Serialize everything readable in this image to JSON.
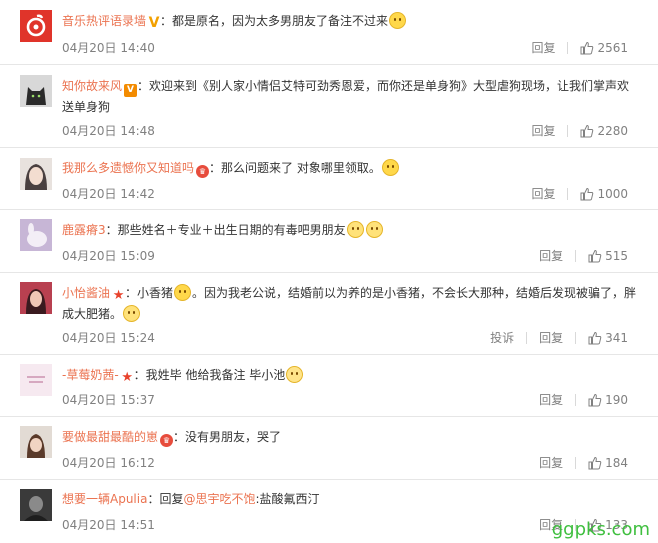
{
  "comments": [
    {
      "user": "音乐热评语录墙",
      "badge": "V",
      "text_before": "：都是原名，因为太多男朋友了备注不过来",
      "time": "04月20日 14:40",
      "reply_label": "回复",
      "likes": "2561",
      "avatar_color": "#e0342a",
      "emoji": "grin-emoji"
    },
    {
      "user": "知你故来风",
      "badge": "V",
      "text": "：欢迎来到《别人家小情侣艾特可劲秀恩爱，而你还是单身狗》大型虐狗现场，让我们掌声欢送单身狗",
      "time": "04月20日 14:48",
      "reply_label": "回复",
      "likes": "2280",
      "avatar_color": "#3a3a3a"
    },
    {
      "user": "我那么多遗憾你又知道吗",
      "badge": "♛",
      "text": "：那么问题来了 对象哪里领取。",
      "time": "04月20日 14:42",
      "reply_label": "回复",
      "likes": "1000",
      "avatar_color": "#d9cfc7",
      "emoji": "sweat-emoji"
    },
    {
      "user": "鹿露瘠3",
      "text": "：那些姓名＋专业＋出生日期的有毒吧男朋友",
      "time": "04月20日 15:09",
      "reply_label": "回复",
      "likes": "515",
      "avatar_color": "#b9a8c9",
      "emoji": "laugh-cry-emoji"
    },
    {
      "user": "小怡酱油",
      "badge": "★",
      "text_a": "：小香猪",
      "text_b": "。因为我老公说，结婚前以为养的是小香猪，不会长大那种，结婚后发现被骗了，胖成大肥猪。",
      "time": "04月20日 15:24",
      "report_label": "投诉",
      "reply_label": "回复",
      "likes": "341",
      "avatar_color": "#8a2f3a",
      "emoji": "smile-emoji"
    },
    {
      "user": "-草莓奶茜-",
      "badge": "★",
      "text": "：我姓毕 他给我备注 毕小池",
      "time": "04月20日 15:37",
      "reply_label": "回复",
      "likes": "190",
      "avatar_color": "#f2e6ee",
      "emoji": "eye-roll-emoji"
    },
    {
      "user": "要做最甜最酷的崽",
      "badge": "♛",
      "text": "：没有男朋友，哭了",
      "time": "04月20日 16:12",
      "reply_label": "回复",
      "likes": "184",
      "avatar_color": "#c8b8a8"
    },
    {
      "user": "想要一辆Apulia",
      "text_a": "：回复",
      "mention": "@思宇吃不饱",
      "text_b": ":盐酸氟西汀",
      "time": "04月20日 14:51",
      "reply_label": "回复",
      "likes": "133",
      "avatar_color": "#2f2f2f"
    }
  ],
  "watermark": "ggpks.com"
}
